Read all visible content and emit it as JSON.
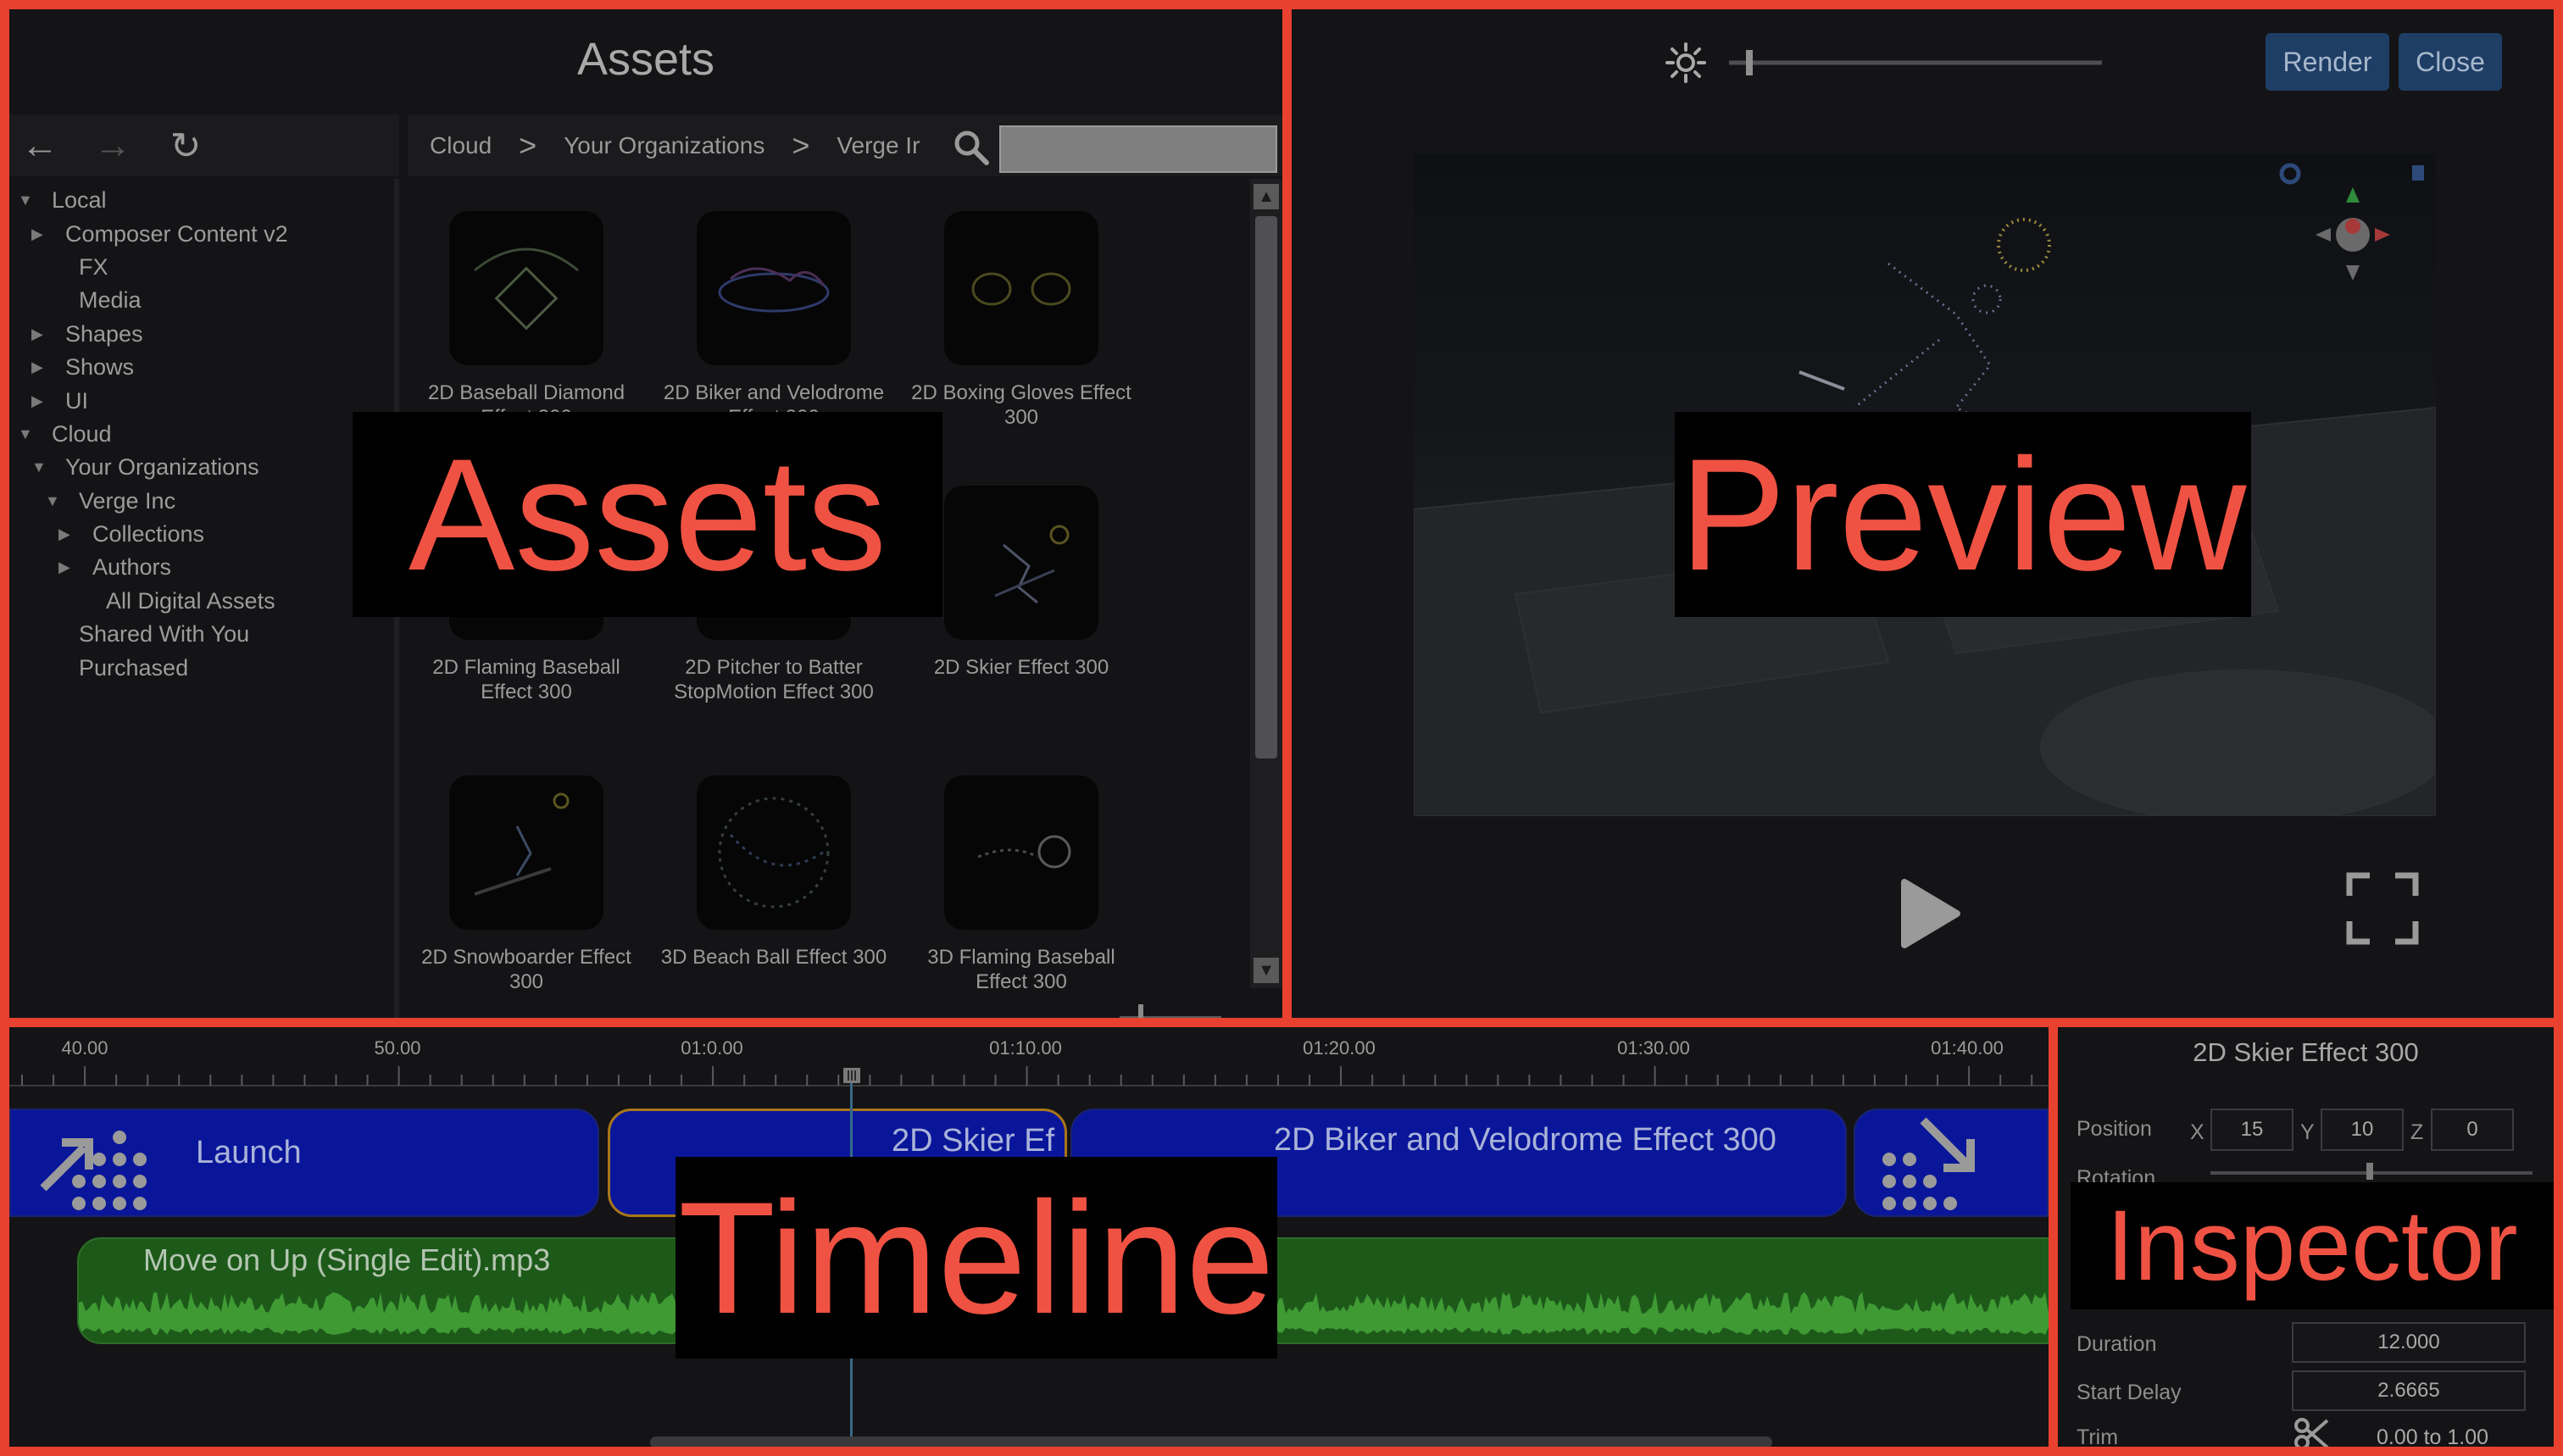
{
  "assets": {
    "title": "Assets",
    "overlay_label": "Assets",
    "nav": {
      "back": "←",
      "forward": "→",
      "refresh": "↻"
    },
    "breadcrumb": [
      "Cloud",
      "Your Organizations",
      "Verge Ir"
    ],
    "breadcrumb_sep": ">",
    "tree": [
      {
        "label": "Local",
        "arrow": "▼"
      },
      {
        "label": "Composer Content v2",
        "arrow": "▶"
      },
      {
        "label": "FX",
        "arrow": ""
      },
      {
        "label": "Media",
        "arrow": ""
      },
      {
        "label": "Shapes",
        "arrow": "▶"
      },
      {
        "label": "Shows",
        "arrow": "▶"
      },
      {
        "label": "UI",
        "arrow": "▶"
      },
      {
        "label": "Cloud",
        "arrow": "▼"
      },
      {
        "label": "Your Organizations",
        "arrow": "▼"
      },
      {
        "label": "Verge Inc",
        "arrow": "▼"
      },
      {
        "label": "Collections",
        "arrow": "▶"
      },
      {
        "label": "Authors",
        "arrow": "▶"
      },
      {
        "label": "All Digital Assets",
        "arrow": ""
      },
      {
        "label": "Shared With You",
        "arrow": ""
      },
      {
        "label": "Purchased",
        "arrow": ""
      }
    ],
    "tiles": [
      "2D Baseball Diamond Effect 300",
      "2D Biker and Velodrome Effect 300",
      "2D Boxing Gloves Effect 300",
      "2D Flaming  Baseball Effect 300",
      "2D Pitcher to Batter StopMotion Effect 300",
      "2D Skier Effect 300",
      "2D Snowboarder Effect 300",
      "3D Beach Ball Effect 300",
      "3D Flaming Baseball Effect 300"
    ],
    "scroll_up": "▲",
    "scroll_down": "▼"
  },
  "preview": {
    "overlay_label": "Preview",
    "render_label": "Render",
    "close_label": "Close"
  },
  "timeline": {
    "overlay_label": "Timeline",
    "ticks": [
      "40.00",
      "50.00",
      "01:0.00",
      "01:10.00",
      "01:20.00",
      "01:30.00",
      "01:40.00"
    ],
    "clips": {
      "launch": "Launch",
      "skier": "2D Skier Ef",
      "biker": "2D Biker and Velodrome Effect 300"
    },
    "audio": "Move on Up (Single Edit).mp3"
  },
  "inspector": {
    "overlay_label": "Inspector",
    "title": "2D Skier Effect 300",
    "position_label": "Position",
    "x_label": "X",
    "x": "15",
    "y_label": "Y",
    "y": "10",
    "z_label": "Z",
    "z": "0",
    "rotation_label": "Rotation",
    "duration_label": "Duration",
    "duration": "12.000",
    "start_delay_label": "Start Delay",
    "start_delay": "2.6665",
    "trim_label": "Trim",
    "trim": "0.00 to 1.00"
  },
  "colors": {
    "accent": "#e8412f",
    "overlay_text": "#ef5243",
    "clip_blue": "#0a1a9e",
    "audio_green": "#1d5a1a",
    "button": "#1f3e66"
  }
}
